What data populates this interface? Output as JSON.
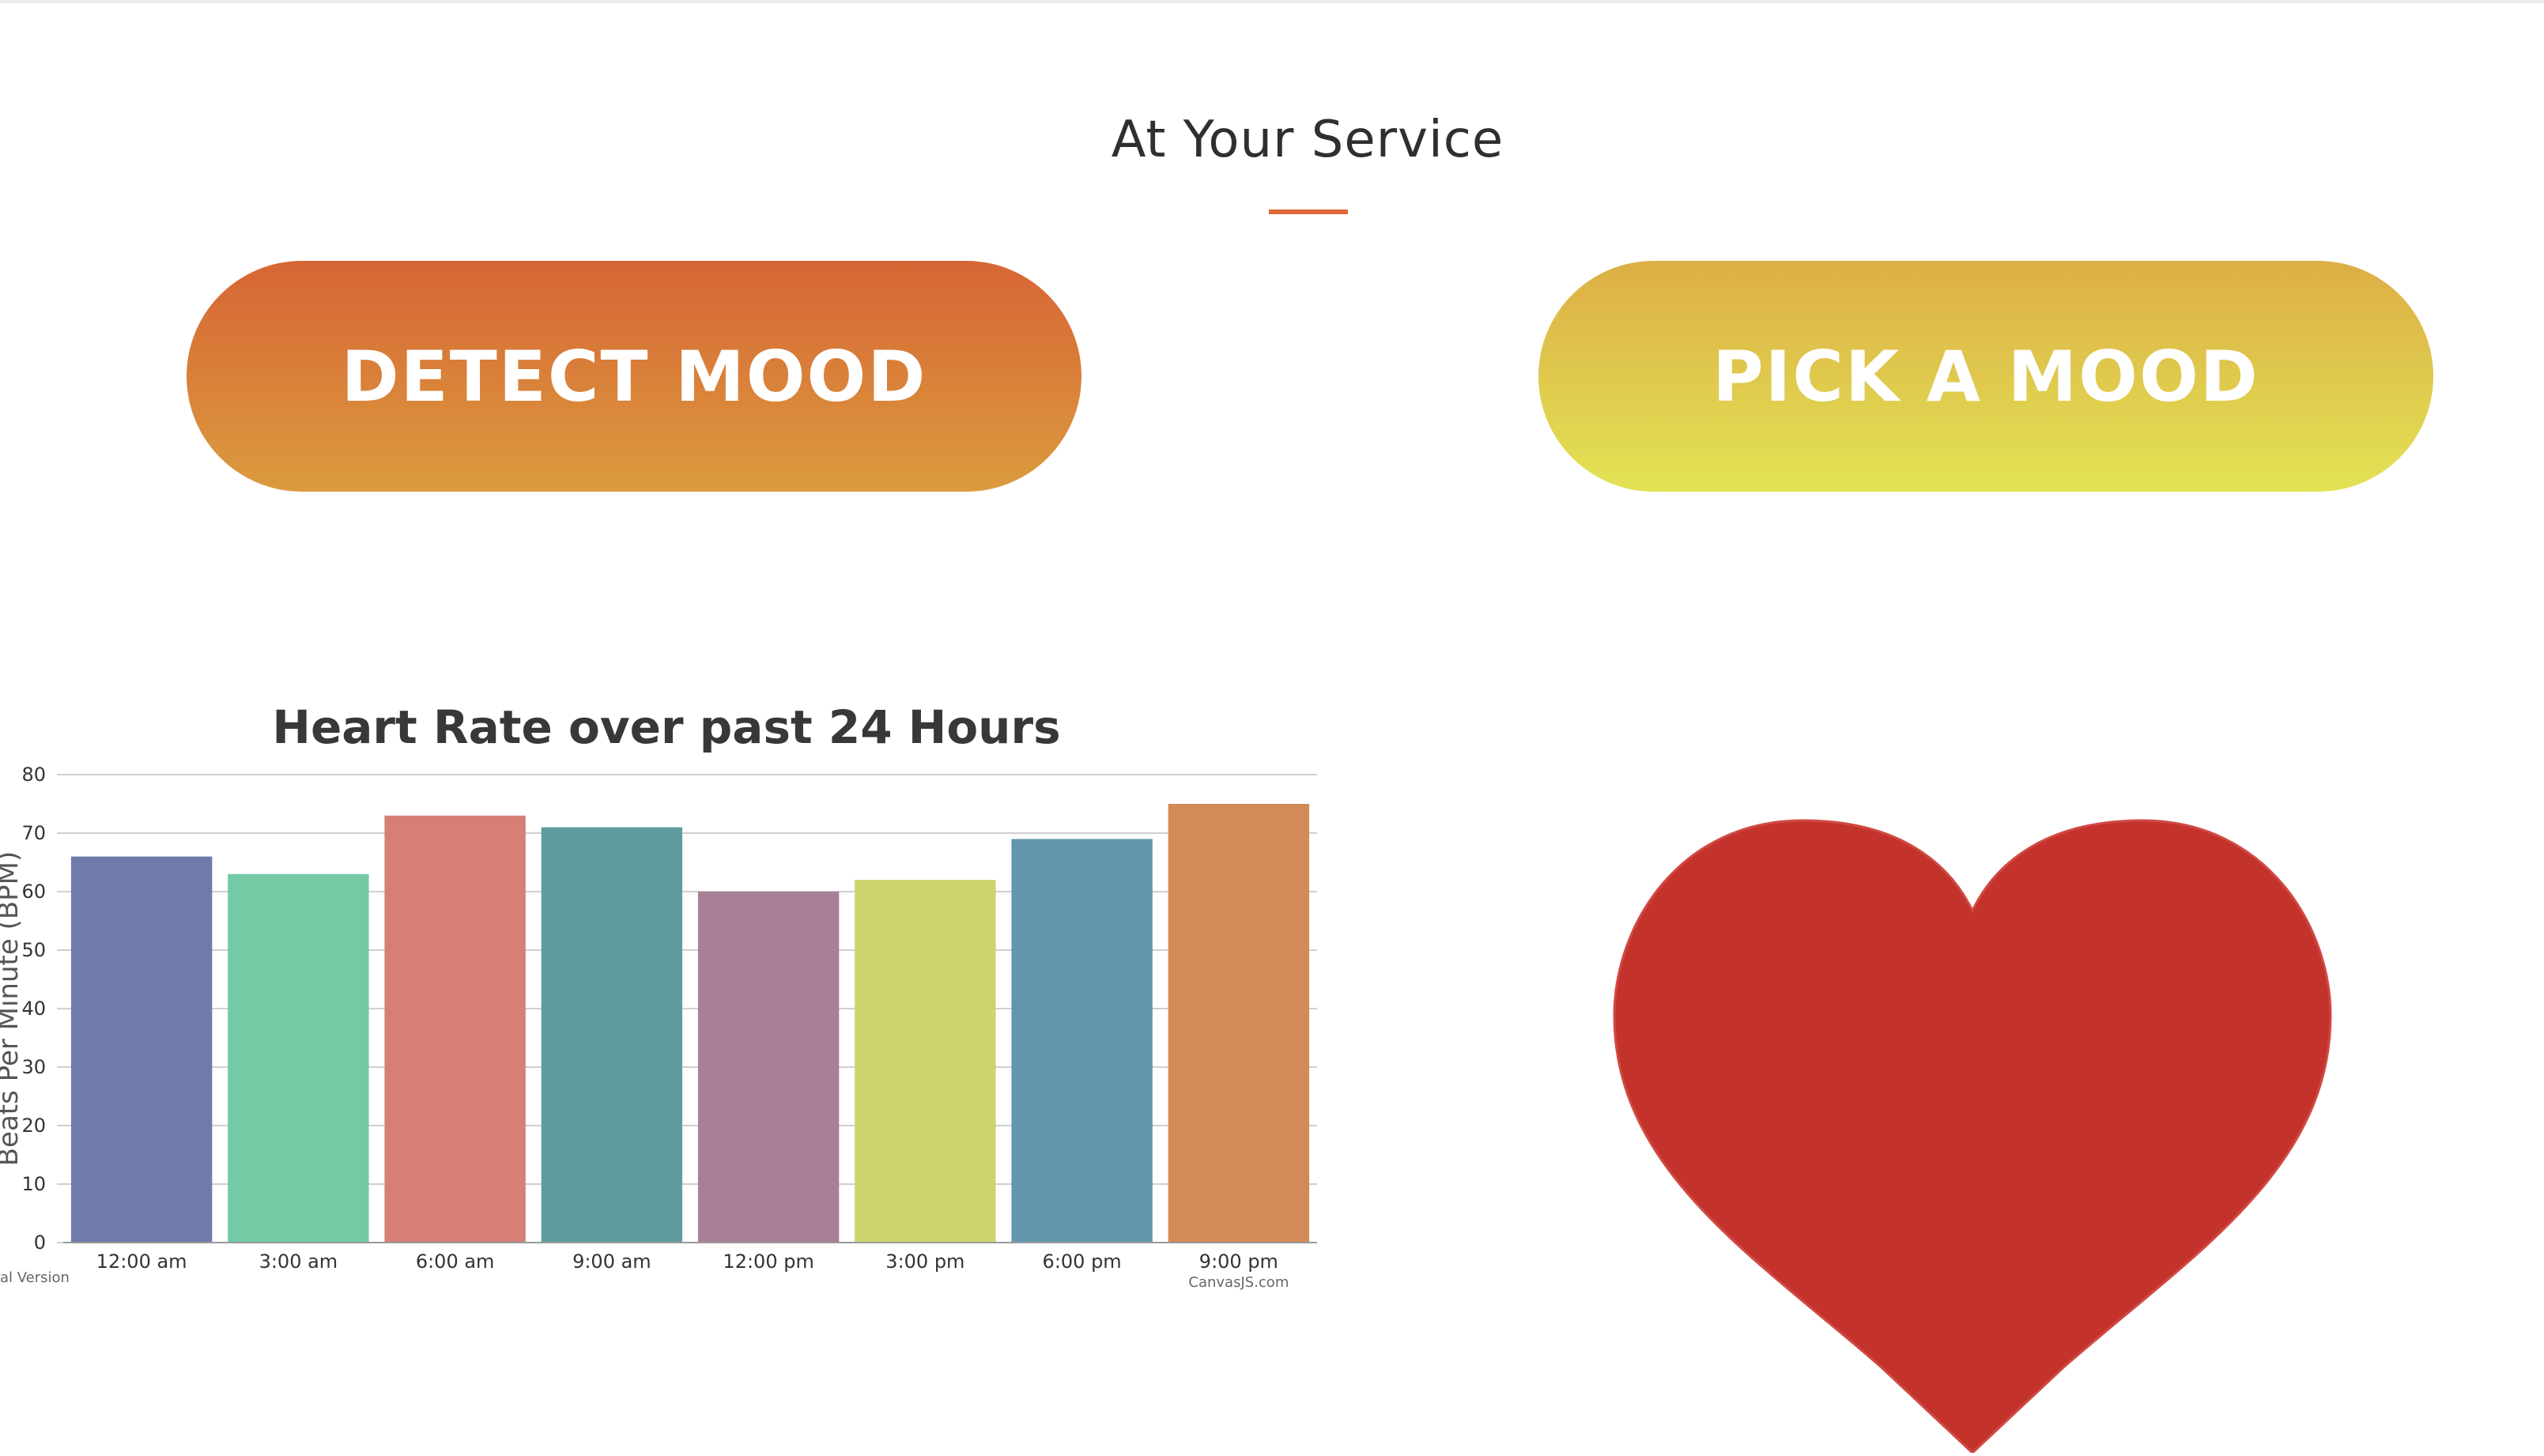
{
  "section": {
    "title": "At Your Service"
  },
  "buttons": {
    "detect": "DETECT MOOD",
    "pick": "PICK A MOOD"
  },
  "chart_data": {
    "type": "bar",
    "title": "Heart Rate over past 24 Hours",
    "ylabel": "Beats Per Minute (BPM)",
    "xlabel": "",
    "categories": [
      "12:00 am",
      "3:00 am",
      "6:00 am",
      "9:00 am",
      "12:00 pm",
      "3:00 pm",
      "6:00 pm",
      "9:00 pm"
    ],
    "values": [
      66,
      63,
      73,
      71,
      60,
      62,
      69,
      75
    ],
    "colors": [
      "#6f7bab",
      "#74caa4",
      "#d57f77",
      "#5f9c9f",
      "#a87f97",
      "#cdd46e",
      "#6296ad",
      "#d48a57"
    ],
    "ylim": [
      0,
      80
    ],
    "yticks": [
      0,
      10,
      20,
      30,
      40,
      50,
      60,
      70,
      80
    ],
    "grid": true,
    "legend": "none",
    "watermark_left": "al Version",
    "watermark_right": "CanvasJS.com"
  },
  "heart": {
    "icon": "heart-icon",
    "color": "#c4322c"
  }
}
